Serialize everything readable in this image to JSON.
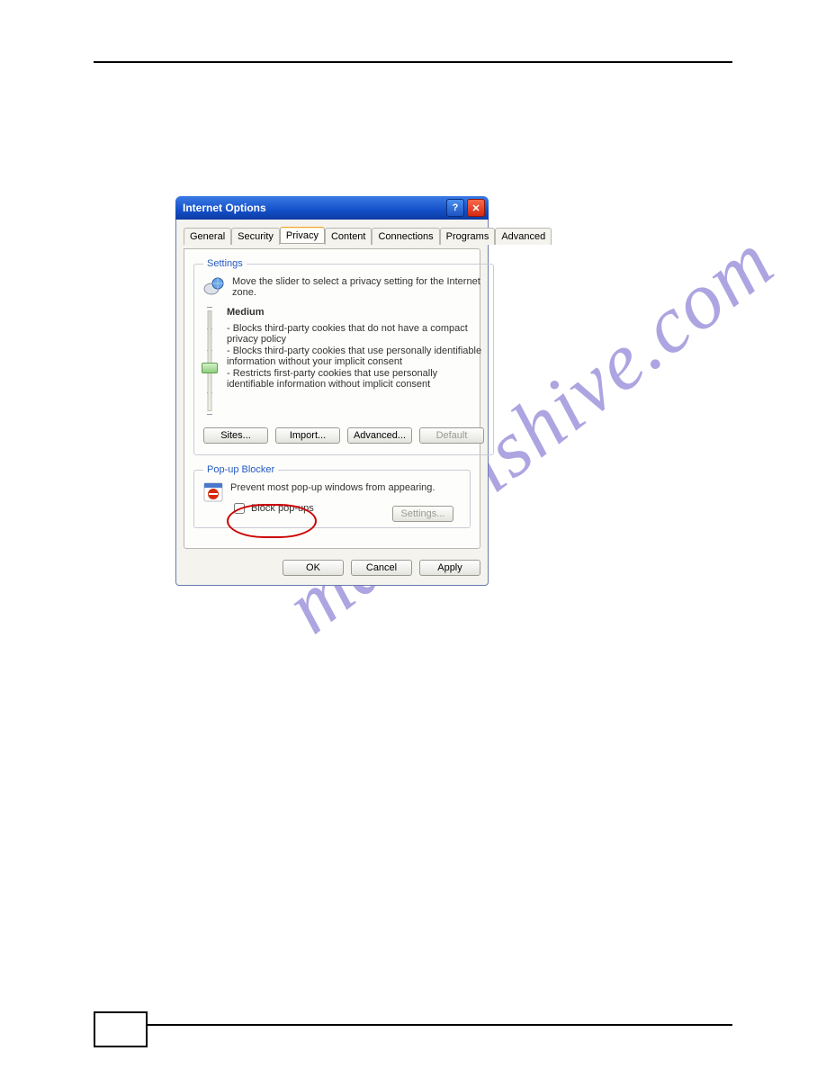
{
  "watermark": "manualshive.com",
  "dialog": {
    "title": "Internet Options",
    "help": "?",
    "close": "✕",
    "tabs": [
      "General",
      "Security",
      "Privacy",
      "Content",
      "Connections",
      "Programs",
      "Advanced"
    ],
    "active_tab": "Privacy",
    "settings": {
      "legend": "Settings",
      "intro": "Move the slider to select a privacy setting for the Internet zone.",
      "level": "Medium",
      "bullets": [
        "- Blocks third-party cookies that do not have a compact privacy policy",
        "- Blocks third-party cookies that use personally identifiable information without your implicit consent",
        "- Restricts first-party cookies that use personally identifiable information without implicit consent"
      ],
      "buttons": {
        "sites": "Sites...",
        "import": "Import...",
        "advanced": "Advanced...",
        "default": "Default"
      }
    },
    "popup": {
      "legend": "Pop-up Blocker",
      "intro": "Prevent most pop-up windows from appearing.",
      "checkbox_label": "Block pop-ups",
      "settings_btn": "Settings..."
    },
    "bottom": {
      "ok": "OK",
      "cancel": "Cancel",
      "apply": "Apply"
    }
  }
}
